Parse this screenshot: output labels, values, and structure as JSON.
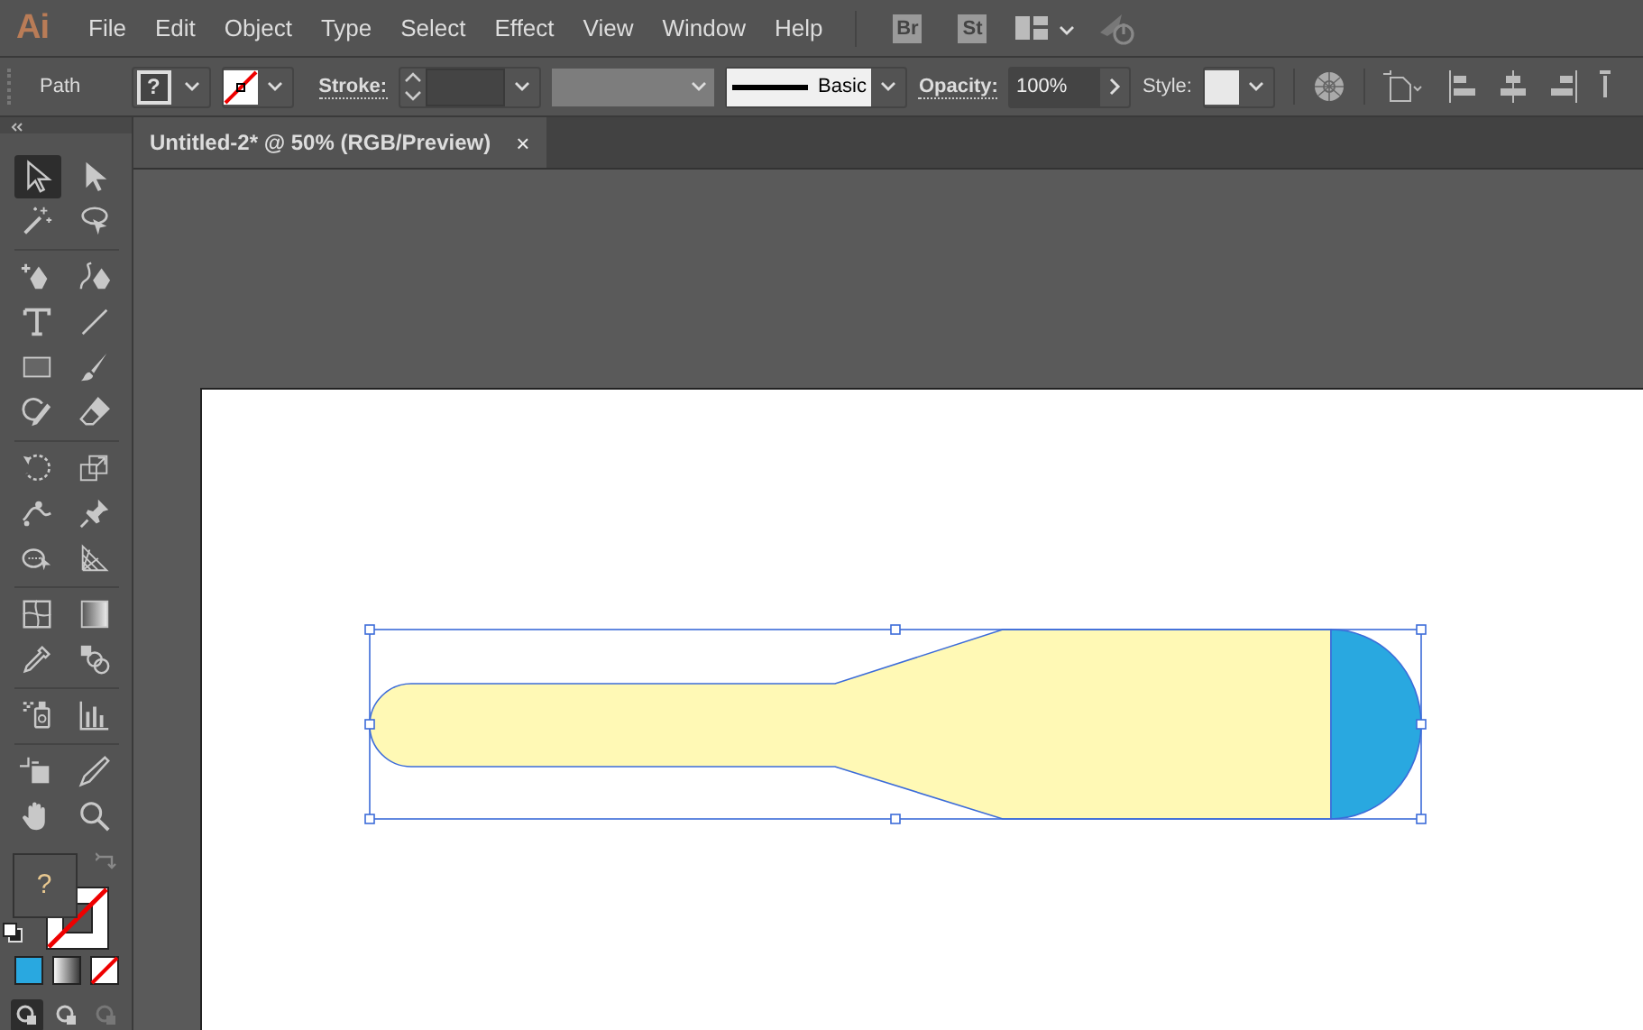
{
  "app": {
    "logo": "Ai",
    "menu": [
      "File",
      "Edit",
      "Object",
      "Type",
      "Select",
      "Effect",
      "View",
      "Window",
      "Help"
    ],
    "bridges": [
      "Br",
      "St"
    ]
  },
  "control_bar": {
    "selection_type": "Path",
    "fill_label": "?",
    "stroke_label": "Stroke:",
    "profile": "Basic",
    "opacity_label": "Opacity:",
    "opacity": "100%",
    "style_label": "Style:"
  },
  "document_tab": {
    "title": "Untitled-2* @ 50% (RGB/Preview)",
    "close": "×",
    "selected": true
  },
  "tools": [
    {
      "selected": true
    },
    {
      "selected": false
    },
    {
      "selected": false
    },
    {
      "selected": false
    },
    {
      "selected": false
    },
    {
      "selected": false
    },
    {
      "selected": false
    },
    {
      "selected": false
    },
    {
      "selected": false
    },
    {
      "selected": false
    },
    {
      "selected": false
    },
    {
      "selected": false
    },
    {
      "selected": false
    },
    {
      "selected": false
    },
    {
      "selected": false
    },
    {
      "selected": false
    },
    {
      "selected": false
    },
    {
      "selected": false
    },
    {
      "selected": false
    },
    {
      "selected": false
    },
    {
      "selected": false
    },
    {
      "selected": false
    },
    {
      "selected": false
    },
    {
      "selected": false
    },
    {
      "selected": false
    },
    {
      "selected": false
    },
    {
      "selected": false
    },
    {
      "selected": false
    }
  ],
  "fill_swatch": {
    "label": "?"
  },
  "draw_modes": [
    {
      "selected": true
    },
    {
      "selected": false
    },
    {
      "selected": false
    }
  ]
}
